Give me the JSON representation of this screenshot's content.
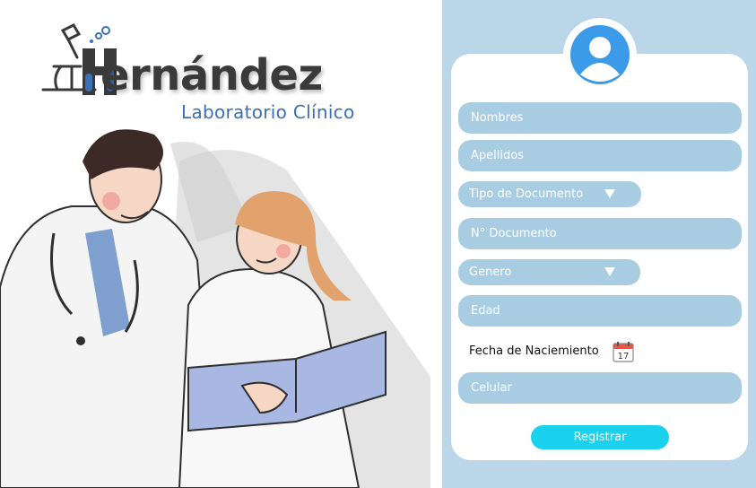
{
  "brand": {
    "name": "ernández",
    "subtitle": "Laboratorio Clínico",
    "logo_icon": "microscope-h-icon"
  },
  "illustration": {
    "icon": "doctors-reviewing-folder-illustration"
  },
  "form": {
    "avatar_icon": "user-avatar-icon",
    "fields": {
      "nombres": {
        "placeholder": "Nombres"
      },
      "apellidos": {
        "placeholder": "Apellidos"
      },
      "tipo_documento": {
        "value": "Tipo de Documento"
      },
      "numero_documento": {
        "placeholder": "N° Documento"
      },
      "genero": {
        "value": "Genero"
      },
      "edad": {
        "placeholder": "Edad"
      },
      "fecha_nacimiento": {
        "label": "Fecha de Naciemiento",
        "icon": "calendar-icon",
        "day": "17"
      },
      "celular": {
        "placeholder": "Celular"
      }
    },
    "submit_label": "Registrar"
  },
  "colors": {
    "panel_bg": "#bad6e8",
    "field_bg": "#a8cde3",
    "button_bg": "#1ad1ee",
    "avatar_blue": "#3c9be8",
    "subtitle_blue": "#3d6fb6"
  }
}
